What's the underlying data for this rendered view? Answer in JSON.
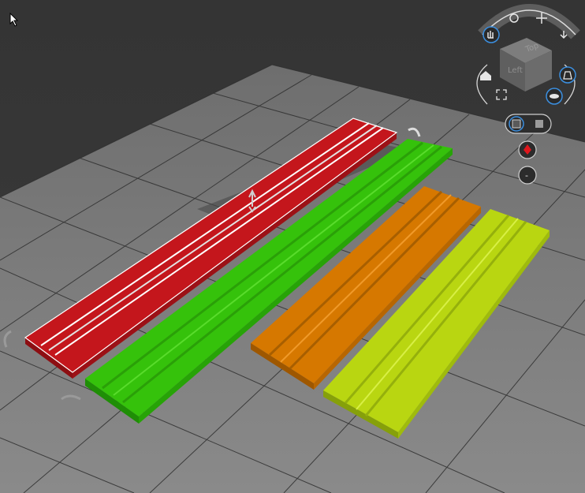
{
  "viewport": {
    "background": "#343434",
    "floor_color": "#7e7e7e",
    "grid_line_color": "#2c2c2c"
  },
  "view_cube": {
    "face_top": "Top",
    "face_left": "Left",
    "face_color": "#6b6b6b",
    "ring_color": "#d8d8d8"
  },
  "nav_icons": {
    "rotate": "rotate-icon",
    "pan": "move-icon",
    "orbit": "hand-icon",
    "down": "arrow-down-icon",
    "home": "home-icon",
    "fit": "fit-view-icon",
    "perspective": "perspective-icon",
    "layers": "layers-icon",
    "ortho": "ortho-view-icon",
    "solid": "solid-view-icon",
    "color": "color-drop-icon",
    "minus": "minus-icon"
  },
  "models": [
    {
      "name": "red-rail",
      "color": "#c4161c",
      "selected": true
    },
    {
      "name": "green-rail",
      "color": "#35c20b",
      "selected": false
    },
    {
      "name": "orange-rail",
      "color": "#d67800",
      "selected": false
    },
    {
      "name": "yellow-rail",
      "color": "#b9d611",
      "selected": false
    }
  ],
  "labels": {
    "minus": "-"
  }
}
